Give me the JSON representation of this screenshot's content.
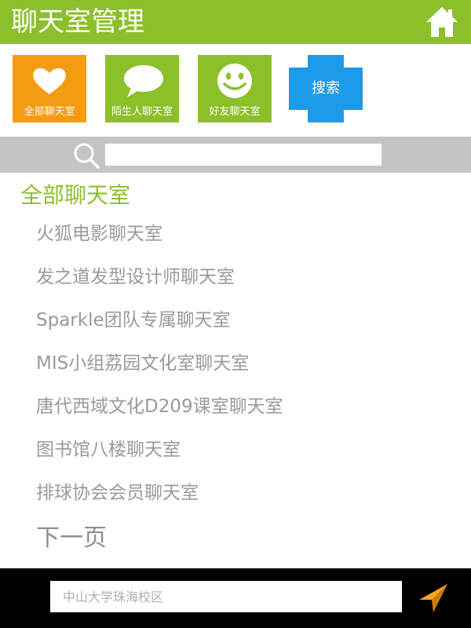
{
  "header": {
    "title": "聊天室管理"
  },
  "tiles": [
    {
      "label": "全部聊天室",
      "icon": "heart-icon",
      "color": "#f39c12"
    },
    {
      "label": "陌生人聊天室",
      "icon": "speech-bubble-icon",
      "color": "#8cc02a"
    },
    {
      "label": "好友聊天室",
      "icon": "smiley-icon",
      "color": "#8cc02a"
    },
    {
      "label": "搜索",
      "icon": "cross-shape",
      "color": "#1e9be8"
    }
  ],
  "search": {
    "value": ""
  },
  "section": {
    "title": "全部聊天室"
  },
  "rooms": [
    "火狐电影聊天室",
    "发之道发型设计师聊天室",
    "Sparkle团队专属聊天室",
    "MIS小组荔园文化室聊天室",
    "唐代西域文化D209课室聊天室",
    "图书馆八楼聊天室",
    "排球协会会员聊天室"
  ],
  "pagination": {
    "next": "下一页"
  },
  "footer": {
    "location_placeholder": "中山大学珠海校区"
  },
  "colors": {
    "accent": "#8cc02a",
    "orange": "#f39c12",
    "blue": "#1e9be8",
    "nav_orange": "#f5a623"
  }
}
